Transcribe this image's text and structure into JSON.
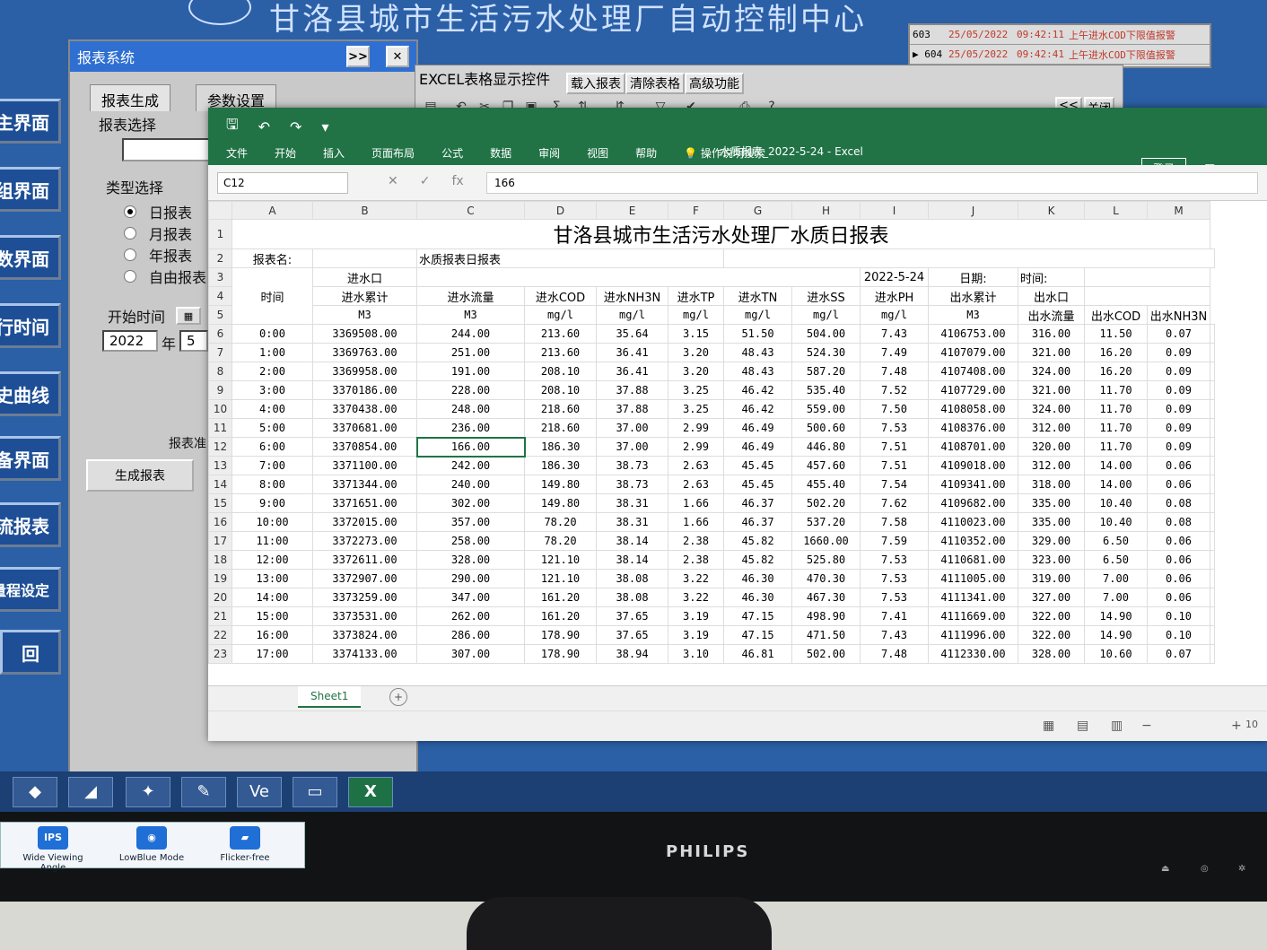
{
  "scada": {
    "title": "甘洛县城市生活污水处理厂自动控制中心",
    "alarms": [
      {
        "id": "603",
        "date": "25/05/2022",
        "time": "09:42:11",
        "text": "上午进水COD下限值报警"
      },
      {
        "id": "▶ 604",
        "date": "25/05/2022",
        "time": "09:42:41",
        "text": "上午进水COD下限值报警"
      }
    ],
    "nav": [
      "主界面",
      "组界面",
      "数界面",
      "行时间",
      "史曲线",
      "备界面",
      "流报表",
      "量程设定",
      "回"
    ]
  },
  "report_panel": {
    "title": "报表系统",
    "btn_next": ">>",
    "btn_close": "✕",
    "tabs": [
      "报表生成",
      "参数设置"
    ],
    "select_label": "报表选择",
    "type_label": "类型选择",
    "types": [
      "日报表",
      "月报表",
      "年报表",
      "自由报表"
    ],
    "selected_type": 0,
    "start_label": "开始时间",
    "year": "2022",
    "year_unit": "年",
    "month": "5",
    "ready_label": "报表准",
    "generate_btn": "生成报表"
  },
  "excel_control": {
    "label": "EXCEL表格显示控件",
    "buttons": [
      "载入报表",
      "清除表格",
      "高级功能"
    ],
    "nav_btn": "<<",
    "close_btn": "关闭"
  },
  "excel": {
    "window_title": "水质报表_2022-5-24  -  Excel",
    "menus": [
      "文件",
      "开始",
      "插入",
      "页面布局",
      "公式",
      "数据",
      "审阅",
      "视图",
      "帮助",
      "操作说明搜索"
    ],
    "login": "登录",
    "name_box": "C12",
    "formula_value": "166",
    "columns": [
      "A",
      "B",
      "C",
      "D",
      "E",
      "F",
      "G",
      "H",
      "I",
      "J",
      "K",
      "L",
      "M"
    ],
    "report_title": "甘洛县城市生活污水处理厂水质日报表",
    "name_label": "报表名:",
    "name_value": "水质报表日报表",
    "date_value": "2022-5-24",
    "date_label": "日期:",
    "time_label": "时间:",
    "time_header": "时间",
    "inlet_group": "进水口",
    "outlet_group": "出水口",
    "headers": [
      "进水累计",
      "进水流量",
      "进水COD",
      "进水NH3N",
      "进水TP",
      "进水TN",
      "进水SS",
      "进水PH",
      "出水累计",
      "出水流量",
      "出水COD",
      "出水NH3N"
    ],
    "units": [
      "M3",
      "M3",
      "mg/l",
      "mg/l",
      "mg/l",
      "mg/l",
      "mg/l",
      "mg/l",
      "M3",
      "M3",
      "mg/l",
      "mg/l"
    ],
    "rows": [
      [
        "0:00",
        "3369508.00",
        "244.00",
        "213.60",
        "35.64",
        "3.15",
        "51.50",
        "504.00",
        "7.43",
        "4106753.00",
        "316.00",
        "11.50",
        "0.07"
      ],
      [
        "1:00",
        "3369763.00",
        "251.00",
        "213.60",
        "36.41",
        "3.20",
        "48.43",
        "524.30",
        "7.49",
        "4107079.00",
        "321.00",
        "16.20",
        "0.09"
      ],
      [
        "2:00",
        "3369958.00",
        "191.00",
        "208.10",
        "36.41",
        "3.20",
        "48.43",
        "587.20",
        "7.48",
        "4107408.00",
        "324.00",
        "16.20",
        "0.09"
      ],
      [
        "3:00",
        "3370186.00",
        "228.00",
        "208.10",
        "37.88",
        "3.25",
        "46.42",
        "535.40",
        "7.52",
        "4107729.00",
        "321.00",
        "11.70",
        "0.09"
      ],
      [
        "4:00",
        "3370438.00",
        "248.00",
        "218.60",
        "37.88",
        "3.25",
        "46.42",
        "559.00",
        "7.50",
        "4108058.00",
        "324.00",
        "11.70",
        "0.09"
      ],
      [
        "5:00",
        "3370681.00",
        "236.00",
        "218.60",
        "37.00",
        "2.99",
        "46.49",
        "500.60",
        "7.53",
        "4108376.00",
        "312.00",
        "11.70",
        "0.09"
      ],
      [
        "6:00",
        "3370854.00",
        "166.00",
        "186.30",
        "37.00",
        "2.99",
        "46.49",
        "446.80",
        "7.51",
        "4108701.00",
        "320.00",
        "11.70",
        "0.09"
      ],
      [
        "7:00",
        "3371100.00",
        "242.00",
        "186.30",
        "38.73",
        "2.63",
        "45.45",
        "457.60",
        "7.51",
        "4109018.00",
        "312.00",
        "14.00",
        "0.06"
      ],
      [
        "8:00",
        "3371344.00",
        "240.00",
        "149.80",
        "38.73",
        "2.63",
        "45.45",
        "455.40",
        "7.54",
        "4109341.00",
        "318.00",
        "14.00",
        "0.06"
      ],
      [
        "9:00",
        "3371651.00",
        "302.00",
        "149.80",
        "38.31",
        "1.66",
        "46.37",
        "502.20",
        "7.62",
        "4109682.00",
        "335.00",
        "10.40",
        "0.08"
      ],
      [
        "10:00",
        "3372015.00",
        "357.00",
        "78.20",
        "38.31",
        "1.66",
        "46.37",
        "537.20",
        "7.58",
        "4110023.00",
        "335.00",
        "10.40",
        "0.08"
      ],
      [
        "11:00",
        "3372273.00",
        "258.00",
        "78.20",
        "38.14",
        "2.38",
        "45.82",
        "1660.00",
        "7.59",
        "4110352.00",
        "329.00",
        "6.50",
        "0.06"
      ],
      [
        "12:00",
        "3372611.00",
        "328.00",
        "121.10",
        "38.14",
        "2.38",
        "45.82",
        "525.80",
        "7.53",
        "4110681.00",
        "323.00",
        "6.50",
        "0.06"
      ],
      [
        "13:00",
        "3372907.00",
        "290.00",
        "121.10",
        "38.08",
        "3.22",
        "46.30",
        "470.30",
        "7.53",
        "4111005.00",
        "319.00",
        "7.00",
        "0.06"
      ],
      [
        "14:00",
        "3373259.00",
        "347.00",
        "161.20",
        "38.08",
        "3.22",
        "46.30",
        "467.30",
        "7.53",
        "4111341.00",
        "327.00",
        "7.00",
        "0.06"
      ],
      [
        "15:00",
        "3373531.00",
        "262.00",
        "161.20",
        "37.65",
        "3.19",
        "47.15",
        "498.90",
        "7.41",
        "4111669.00",
        "322.00",
        "14.90",
        "0.10"
      ],
      [
        "16:00",
        "3373824.00",
        "286.00",
        "178.90",
        "37.65",
        "3.19",
        "47.15",
        "471.50",
        "7.43",
        "4111996.00",
        "322.00",
        "14.90",
        "0.10"
      ],
      [
        "17:00",
        "3374133.00",
        "307.00",
        "178.90",
        "38.94",
        "3.10",
        "46.81",
        "502.00",
        "7.48",
        "4112330.00",
        "328.00",
        "10.60",
        "0.07"
      ]
    ],
    "sheet_tab": "Sheet1",
    "zoom": "10"
  },
  "taskbar": {
    "excel_icon": "X",
    "ve_icon": "Ve"
  },
  "monitor": {
    "brand": "PHILIPS",
    "stickers": [
      "Wide Viewing Angle",
      "LowBlue Mode",
      "Flicker-free"
    ],
    "ips": "IPS"
  }
}
